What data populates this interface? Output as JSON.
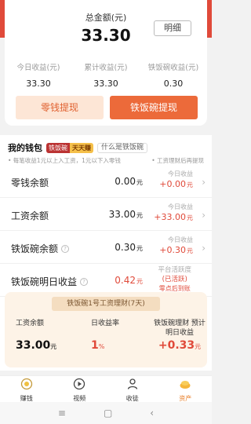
{
  "summary": {
    "total_label": "总金额(元)",
    "total_value": "33.30",
    "detail_label": "明细",
    "stats": [
      {
        "label": "今日收益(元)",
        "value": "33.30"
      },
      {
        "label": "累计收益(元)",
        "value": "33.30"
      },
      {
        "label": "铁饭碗收益(元)",
        "value": "0.30"
      }
    ],
    "withdraw_change_label": "零钱提现",
    "withdraw_bowl_label": "铁饭碗提现"
  },
  "wallet": {
    "title": "我的钱包",
    "tag_left": "铁饭碗",
    "tag_right": "天天赚",
    "what_link": "什么是铁饭碗",
    "note_left": "• 每笔收益1元以上入工资，1元以下入零钱",
    "note_right": "• 工资理财后再提现",
    "rows": [
      {
        "label": "零钱余额",
        "value": "0.00",
        "unit": "元",
        "inc_label": "今日收益",
        "inc": "+0.00",
        "inc_unit": "元"
      },
      {
        "label": "工资余额",
        "value": "33.00",
        "unit": "元",
        "inc_label": "今日收益",
        "inc": "+33.00",
        "inc_unit": "元"
      },
      {
        "label": "铁饭碗余额",
        "value": "0.30",
        "unit": "元",
        "inc_label": "今日收益",
        "inc": "+0.30",
        "inc_unit": "元"
      }
    ],
    "rate_row": {
      "label": "铁饭碗明日收益",
      "value": "0.42",
      "unit": "元",
      "side_1": "平台活跃度",
      "side_2": "(已活跃)",
      "side_3": "零点后到账"
    }
  },
  "payroll": {
    "title": "铁饭碗1号工资理财(7天)",
    "col1_label": "工资余额",
    "col1_value": "33.00",
    "col1_unit": "元",
    "col2_label": "日收益率",
    "col2_value": "1",
    "col2_unit": "%",
    "col3_label": "铁饭碗理财 预计明日收益",
    "col3_value": "+0.33",
    "col3_unit": "元"
  },
  "nav": {
    "items": [
      {
        "label": "赚钱"
      },
      {
        "label": "视频"
      },
      {
        "label": "收徒"
      },
      {
        "label": "资产"
      }
    ]
  },
  "colors": {
    "accent": "#e04a3a",
    "orange": "#ec6a3a",
    "active_nav": "#e9822f"
  }
}
